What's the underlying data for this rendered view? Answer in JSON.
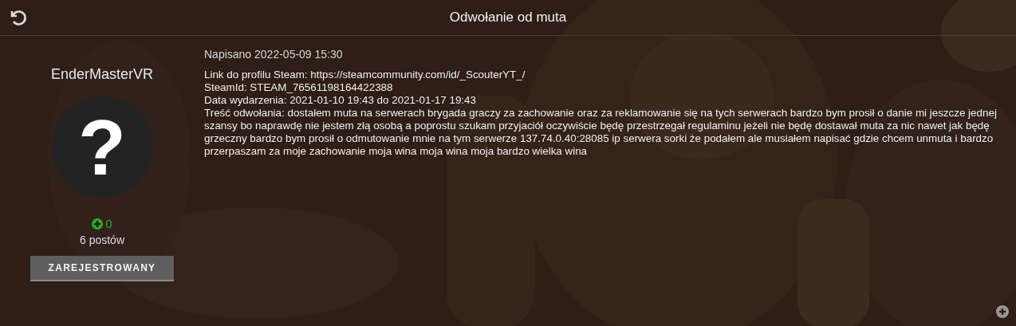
{
  "header": {
    "title": "Odwołanie od muta"
  },
  "author": {
    "name": "EnderMasterVR",
    "avatar_glyph": "?",
    "reputation": "0",
    "posts": "6 postów",
    "rank": "ZAREJESTROWANY"
  },
  "post": {
    "date": "Napisano 2022-05-09 15:30",
    "lines": [
      "Link do profilu Steam: https://steamcommunity.com/id/_ScouterYT_/",
      "SteamId: STEAM_76561198164422388",
      "Data wydarzenia: 2021-01-10 19:43 do 2021-01-17 19:43",
      "Treść odwołania: dostałem muta na serwerach brygada graczy za zachowanie oraz za reklamowanie się na tych serwerach bardzo bym prosił o danie mi jeszcze jednej szansy bo naprawdę nie jestem złą osobą a poprostu szukam przyjaciół oczywiście będę przestrzegał regulaminu jeżeli nie będę dostawał muta za nic nawet jak będę grzeczny bardzo bym prosił o odmutowanie mnie na tym serwerze 137.74.0.40:28085 ip serwera sorki że podałem ale musiałem napisać gdzie chcem unmuta i bardzo przerpaszam za moje zachowanie moja wina moja wina moja bardzo wielka wina"
    ]
  }
}
